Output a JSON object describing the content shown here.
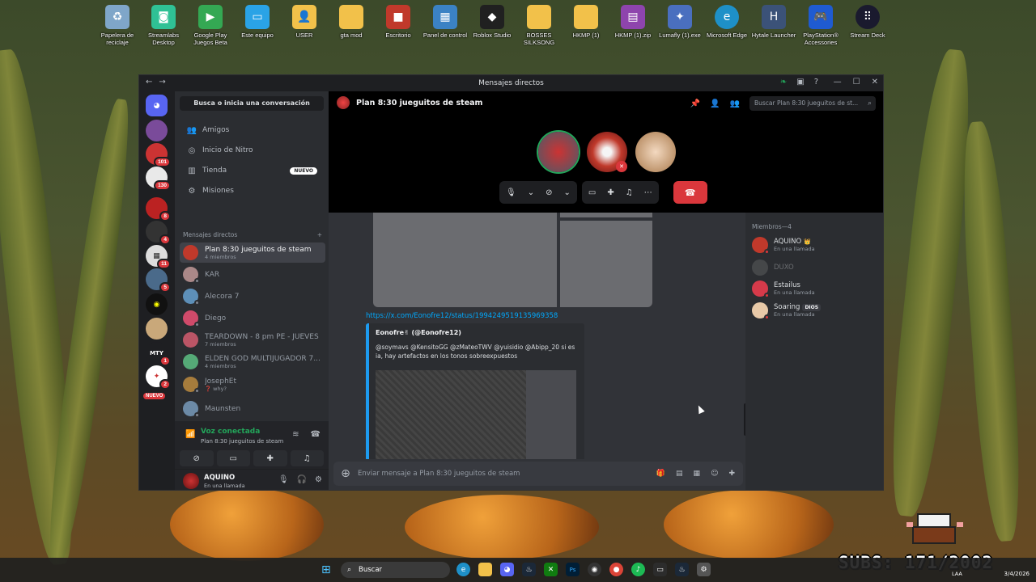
{
  "desktop": {
    "icons": [
      {
        "label": "Papelera de reciclaje",
        "icon": "recycle-bin-icon",
        "color": "#7fa6c9"
      },
      {
        "label": "Streamlabs Desktop",
        "icon": "streamlabs-icon",
        "color": "#2fc195"
      },
      {
        "label": "Google Play Juegos Beta",
        "icon": "google-play-games-icon",
        "color": "#34a853"
      },
      {
        "label": "Este equipo",
        "icon": "this-pc-icon",
        "color": "#2aa3e6"
      },
      {
        "label": "USER",
        "icon": "user-folder-icon",
        "color": "#f2c14a"
      },
      {
        "label": "gta mod",
        "icon": "folder-icon",
        "color": "#f2c14a"
      },
      {
        "label": "Escritorio",
        "icon": "desktop-folder-icon",
        "color": "#c0392b"
      },
      {
        "label": "Panel de control",
        "icon": "control-panel-icon",
        "color": "#3b82c4"
      },
      {
        "label": "Roblox Studio",
        "icon": "roblox-studio-icon",
        "color": "#202020"
      },
      {
        "label": "BOSSES SILKSONG",
        "icon": "folder-icon",
        "color": "#f2c14a"
      },
      {
        "label": "HKMP (1)",
        "icon": "folder-icon",
        "color": "#f2c14a"
      },
      {
        "label": "HKMP (1).zip",
        "icon": "winrar-icon",
        "color": "#8e44ad"
      },
      {
        "label": "Lumafly (1).exe",
        "icon": "lumafly-icon",
        "color": "#4a6fbf"
      },
      {
        "label": "Microsoft Edge",
        "icon": "edge-icon",
        "color": "#1e90c8"
      },
      {
        "label": "Hytale Launcher",
        "icon": "hytale-icon",
        "color": "#3b5278"
      },
      {
        "label": "PlayStation® Accessories",
        "icon": "playstation-icon",
        "color": "#1f5bd1"
      },
      {
        "label": "Stream Deck",
        "icon": "stream-deck-icon",
        "color": "#1a1a2e"
      }
    ]
  },
  "window": {
    "title": "Mensajes directos"
  },
  "rail": {
    "badges": [
      "101",
      "130",
      "8",
      "4",
      "11",
      "5",
      "1",
      "2",
      "NUEVO"
    ]
  },
  "sidebar": {
    "search_label": "Busca o inicia una conversación",
    "nav": [
      {
        "label": "Amigos",
        "icon": "friends-icon"
      },
      {
        "label": "Inicio de Nitro",
        "icon": "nitro-icon"
      },
      {
        "label": "Tienda",
        "icon": "shop-icon",
        "badge": "NUEVO"
      },
      {
        "label": "Misiones",
        "icon": "quests-icon"
      }
    ],
    "dm_header": "Mensajes directos",
    "dm_add": "+",
    "dms": [
      {
        "name": "Plan 8:30 jueguitos de steam",
        "sub": "4 miembros",
        "color": "#c0392b"
      },
      {
        "name": "KAR",
        "sub": "",
        "color": "#a88"
      },
      {
        "name": "Alecora 7",
        "sub": "",
        "color": "#5d8fb8"
      },
      {
        "name": "Diego",
        "sub": "",
        "color": "#d04a6a"
      },
      {
        "name": "TEARDOWN - 8 pm PE - JUEVES",
        "sub": "7 miembros",
        "color": "#b56"
      },
      {
        "name": "ELDEN GOD MULTIJUGADOR 7...",
        "sub": "4 miembros",
        "color": "#5a7"
      },
      {
        "name": "JosephEt",
        "sub": "❓ why?",
        "color": "#a67c3c"
      },
      {
        "name": "Maunsten",
        "sub": "",
        "color": "#6c8aa6"
      }
    ],
    "voice": {
      "title": "Voz conectada",
      "channel": "Plan 8:30 jueguitos de steam"
    },
    "user": {
      "name": "AQUINO",
      "status": "En una llamada"
    }
  },
  "call": {
    "title": "Plan 8:30 jueguitos de steam",
    "search_placeholder": "Buscar Plan 8:30 jueguitos de st..."
  },
  "chat": {
    "link": "https://x.com/Eonofre12/status/1994249519135969358",
    "embed_author": "Eonofre✌ (@Eonofre12)",
    "embed_desc": "@soymavs @KensitoGG @zMateoTWV @yuisidio @Abipp_20 si es ia, hay artefactos en los tonos sobreexpuestos",
    "composer_placeholder": "Enviar mensaje a Plan 8:30 jueguitos de steam"
  },
  "members": {
    "header": "Miembros—4",
    "list": [
      {
        "name": "AQUINO",
        "crown": "👑",
        "status": "En una llamada",
        "color": "#c0392b",
        "offline": false,
        "role": ""
      },
      {
        "name": "DUXO",
        "status": "",
        "color": "#777",
        "offline": true,
        "role": ""
      },
      {
        "name": "Estailus",
        "status": "En una llamada",
        "color": "#d63a4a",
        "offline": false,
        "role": ""
      },
      {
        "name": "Soaring",
        "status": "En una llamada",
        "color": "#e8c9a8",
        "offline": false,
        "role": "DIOS"
      }
    ]
  },
  "taskbar": {
    "search": "Buscar",
    "lang": "LAA",
    "date": "3/4/2026"
  },
  "overlay": {
    "subs": "SUBS: 171/2002"
  }
}
